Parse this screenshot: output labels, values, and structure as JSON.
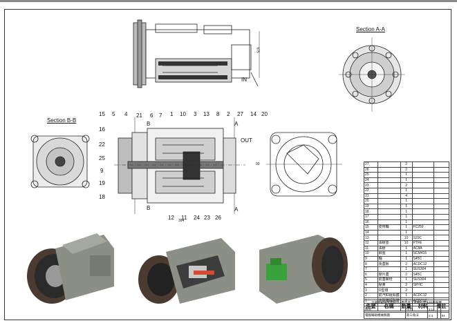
{
  "sheet": {
    "border_color": "#333333",
    "accent_green": "#3aa23a",
    "body_gray": "#8c8f86",
    "pulley_color": "#4a3a30"
  },
  "views": {
    "section_aa_title": "Section A-A",
    "section_bb_title": "Section B-B",
    "top_view_labels": {
      "in": "IN",
      "part_20": "20",
      "dimension": "675"
    },
    "center_section": {
      "section_marks": [
        "B",
        "B",
        "A",
        "A"
      ],
      "out_label": "OUT",
      "dimension_bottom": "394",
      "top_numbers": [
        "15",
        "5",
        "4",
        "21",
        "6",
        "7",
        "1",
        "10",
        "3",
        "13",
        "8",
        "2",
        "27",
        "14"
      ],
      "left_numbers": [
        "16",
        "22",
        "25",
        "9",
        "19",
        "18"
      ],
      "bottom_numbers": [
        "12",
        "11",
        "24",
        "23",
        "26"
      ]
    },
    "front_view_dimension": "90"
  },
  "bom": {
    "header": [
      "件號",
      "名稱",
      "數量",
      "材料",
      "備註"
    ],
    "rows": [
      {
        "no": "27",
        "name": "",
        "qty": "2",
        "mat": "",
        "note": ""
      },
      {
        "no": "26",
        "name": "",
        "qty": "2",
        "mat": "",
        "note": ""
      },
      {
        "no": "25",
        "name": "",
        "qty": "1",
        "mat": "",
        "note": ""
      },
      {
        "no": "24",
        "name": "",
        "qty": "1",
        "mat": "",
        "note": ""
      },
      {
        "no": "23",
        "name": "",
        "qty": "2",
        "mat": "",
        "note": ""
      },
      {
        "no": "22",
        "name": "",
        "qty": "1",
        "mat": "",
        "note": ""
      },
      {
        "no": "21",
        "name": "",
        "qty": "4",
        "mat": "",
        "note": ""
      },
      {
        "no": "20",
        "name": "",
        "qty": "1",
        "mat": "",
        "note": ""
      },
      {
        "no": "19",
        "name": "",
        "qty": "1",
        "mat": "",
        "note": ""
      },
      {
        "no": "18",
        "name": "",
        "qty": "1",
        "mat": "",
        "note": ""
      },
      {
        "no": "17",
        "name": "",
        "qty": "1",
        "mat": "",
        "note": ""
      },
      {
        "no": "16",
        "name": "",
        "qty": "1",
        "mat": "",
        "note": ""
      },
      {
        "no": "15",
        "name": "皮帶輪",
        "qty": "1",
        "mat": "FC250",
        "note": ""
      },
      {
        "no": "14",
        "name": "",
        "qty": "1",
        "mat": "",
        "note": ""
      },
      {
        "no": "13",
        "name": "",
        "qty": "10",
        "mat": "S20C",
        "note": ""
      },
      {
        "no": "12",
        "name": "油壓墊",
        "qty": "10",
        "mat": "PTFE",
        "note": ""
      },
      {
        "no": "11",
        "name": "油壓",
        "qty": "1",
        "mat": "AC8A",
        "note": ""
      },
      {
        "no": "10",
        "name": "斜盤",
        "qty": "1",
        "mat": "SCM415",
        "note": ""
      },
      {
        "no": "9",
        "name": "軸",
        "qty": "1",
        "mat": "S45C",
        "note": ""
      },
      {
        "no": "8",
        "name": "後蓋板",
        "qty": "2",
        "mat": "ACDC12",
        "note": ""
      },
      {
        "no": "7",
        "name": "",
        "qty": "1",
        "mat": "SUS304",
        "note": ""
      },
      {
        "no": "6",
        "name": "壓片蓋",
        "qty": "2",
        "mat": "S45C",
        "note": ""
      },
      {
        "no": "5",
        "name": "前蓋螺栓",
        "qty": "1",
        "mat": "SUS304",
        "note": ""
      },
      {
        "no": "4",
        "name": "壓簧",
        "qty": "2",
        "mat": "SPHC",
        "note": ""
      },
      {
        "no": "3",
        "name": "O型環",
        "qty": "2",
        "mat": "",
        "note": ""
      },
      {
        "no": "2",
        "name": "前汽缸組殼體",
        "qty": "1",
        "mat": "ACDC12",
        "note": ""
      },
      {
        "no": "1",
        "name": "主殼體組殼體",
        "qty": "1",
        "mat": "ACDC12",
        "note": ""
      }
    ]
  },
  "title_block": {
    "school": "全國高級中等學校114學年度工業類科學生技藝競賽",
    "row2": [
      "圖號",
      "比例",
      "1:1",
      "",
      ""
    ],
    "row3": [
      "電腦輔助機械製圖",
      "第三角法",
      "2:3",
      "",
      "04"
    ],
    "drawn_by": "圖號",
    "scale_label": "比例",
    "scale_value": "2:3"
  }
}
